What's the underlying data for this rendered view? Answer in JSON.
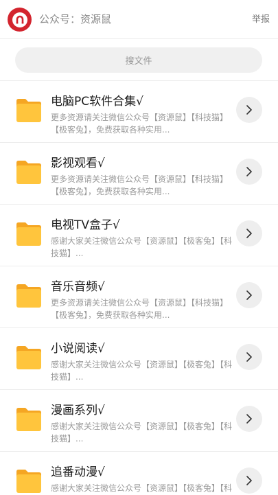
{
  "header": {
    "account_label": "公众号：资源鼠",
    "report_label": "举报",
    "avatar_icon": "horseshoe-magnet-icon",
    "avatar_color": "#d3242e"
  },
  "search": {
    "placeholder": "搜文件"
  },
  "folder_color": "#ffc53d",
  "items": [
    {
      "title": "电脑PC软件合集√",
      "desc": "更多资源请关注微信公众号【资源鼠】【科技猫】【极客兔】，免费获取各种实用...",
      "icon": "folder-icon",
      "action_icon": "chevron-right-icon"
    },
    {
      "title": "影视观看√",
      "desc": "更多资源请关注微信公众号【资源鼠】【科技猫】【极客兔】，免费获取各种实用...",
      "icon": "folder-icon",
      "action_icon": "chevron-right-icon"
    },
    {
      "title": "电视TV盒子√",
      "desc": "感谢大家关注微信公众号【资源鼠】【极客兔】【科技猫】...",
      "icon": "folder-icon",
      "action_icon": "chevron-right-icon"
    },
    {
      "title": "音乐音频√",
      "desc": "更多资源请关注微信公众号【资源鼠】【科技猫】【极客兔】，免费获取各种实用...",
      "icon": "folder-icon",
      "action_icon": "chevron-right-icon"
    },
    {
      "title": "小说阅读√",
      "desc": "感谢大家关注微信公众号【资源鼠】【极客兔】【科技猫】...",
      "icon": "folder-icon",
      "action_icon": "chevron-right-icon"
    },
    {
      "title": "漫画系列√",
      "desc": "感谢大家关注微信公众号【资源鼠】【极客兔】【科技猫】...",
      "icon": "folder-icon",
      "action_icon": "chevron-right-icon"
    },
    {
      "title": "追番动漫√",
      "desc": "感谢大家关注微信公众号【资源鼠】【极客兔】【科技猫】...",
      "icon": "folder-icon",
      "action_icon": "chevron-right-icon"
    }
  ]
}
